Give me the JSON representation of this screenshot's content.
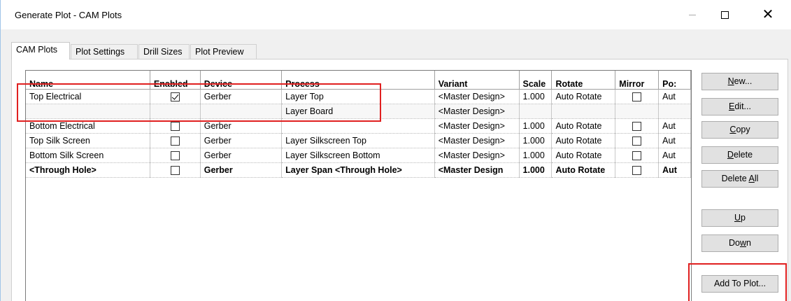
{
  "window": {
    "title": "Generate Plot - CAM Plots"
  },
  "tabs": [
    {
      "label": "CAM Plots"
    },
    {
      "label": "Plot Settings"
    },
    {
      "label": "Drill Sizes"
    },
    {
      "label": "Plot Preview"
    }
  ],
  "table": {
    "columns": [
      "Name",
      "Enabled",
      "Device",
      "Process",
      "Variant",
      "Scale",
      "Rotate",
      "Mirror",
      "Po:"
    ],
    "rows": [
      {
        "name": "Top Electrical",
        "enabled": true,
        "device": "Gerber",
        "process": "Layer Top",
        "variant": "<Master Design>",
        "scale": "1.000",
        "rotate": "Auto Rotate",
        "mirror": false,
        "pos": "Aut"
      },
      {
        "name": "",
        "enabled": null,
        "device": "",
        "process": "Layer Board",
        "variant": "<Master Design>",
        "scale": "",
        "rotate": "",
        "mirror": null,
        "pos": ""
      },
      {
        "name": "Bottom Electrical",
        "enabled": false,
        "device": "Gerber",
        "process": "",
        "variant": "<Master Design>",
        "scale": "1.000",
        "rotate": "Auto Rotate",
        "mirror": false,
        "pos": "Aut"
      },
      {
        "name": "Top Silk Screen",
        "enabled": false,
        "device": "Gerber",
        "process": "Layer Silkscreen Top",
        "variant": "<Master Design>",
        "scale": "1.000",
        "rotate": "Auto Rotate",
        "mirror": false,
        "pos": "Aut"
      },
      {
        "name": "Bottom Silk Screen",
        "enabled": false,
        "device": "Gerber",
        "process": "Layer Silkscreen Bottom",
        "variant": "<Master Design>",
        "scale": "1.000",
        "rotate": "Auto Rotate",
        "mirror": false,
        "pos": "Aut"
      },
      {
        "name": "<Through Hole>",
        "enabled": false,
        "device": "Gerber",
        "process": "Layer Span <Through Hole>",
        "variant": "<Master Design",
        "scale": "1.000",
        "rotate": "Auto Rotate",
        "mirror": false,
        "pos": "Aut"
      }
    ]
  },
  "buttons": {
    "new": {
      "before": "",
      "key": "N",
      "after": "ew..."
    },
    "edit": {
      "before": "",
      "key": "E",
      "after": "dit..."
    },
    "copy": {
      "before": "",
      "key": "C",
      "after": "opy"
    },
    "delete": {
      "before": "",
      "key": "D",
      "after": "elete"
    },
    "delete_all": {
      "before": "Delete ",
      "key": "A",
      "after": "ll"
    },
    "up": {
      "before": "",
      "key": "U",
      "after": "p"
    },
    "down": {
      "before": "Do",
      "key": "w",
      "after": "n"
    },
    "add_to_plot": {
      "before": "Add To Plot...",
      "key": "",
      "after": ""
    }
  },
  "colors": {
    "highlight": "#e02020",
    "window_bg": "#f0f0f0"
  }
}
